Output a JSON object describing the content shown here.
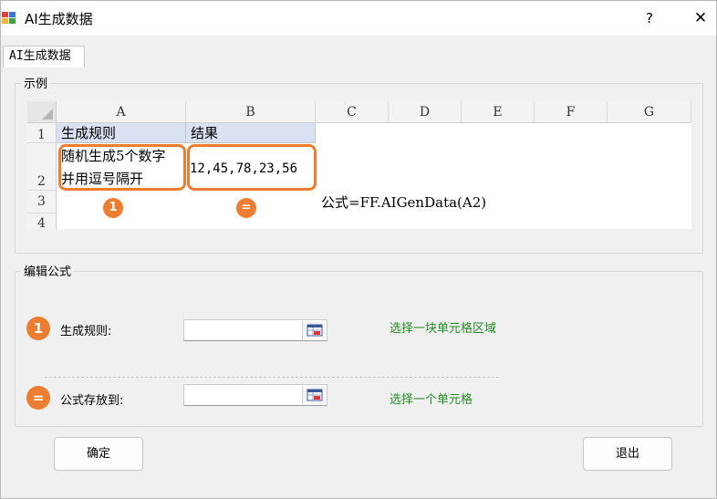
{
  "window": {
    "title": "AI生成数据",
    "help_label": "?",
    "close_label": "✕"
  },
  "tab": {
    "label": "AI生成数据"
  },
  "example": {
    "group_label": "示例",
    "columns": [
      "A",
      "B",
      "C",
      "D",
      "E",
      "F",
      "G"
    ],
    "rows": [
      "1",
      "2",
      "3",
      "4"
    ],
    "cells": {
      "a1": "生成规则",
      "b1": "结果",
      "a2_line1": "随机生成5个数字",
      "a2_line2": "并用逗号隔开",
      "b2": "12,45,78,23,56"
    },
    "badge_one": "1",
    "badge_two": "=",
    "formula": "公式=FF.AIGenData(A2)"
  },
  "edit": {
    "group_label": "编辑公式",
    "rule_badge": "1",
    "rule_label": "生成规则:",
    "rule_value": "",
    "rule_hint": "选择一块单元格区域",
    "store_badge": "=",
    "store_label": "公式存放到:",
    "store_value": "",
    "store_hint": "选择一个单元格"
  },
  "buttons": {
    "ok": "确定",
    "exit": "退出"
  },
  "colors": {
    "accent": "#ed7d31",
    "header_fill": "#d9e1f2",
    "hint_green": "#228b22"
  }
}
